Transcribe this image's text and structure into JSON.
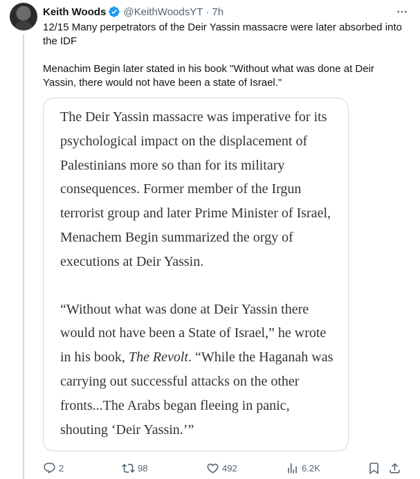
{
  "tweet": {
    "author_name": "Keith Woods",
    "handle": "@KeithWoodsYT",
    "separator": "·",
    "time": "7h",
    "text_lines": [
      "12/15 Many perpetrators of the Deir Yassin massacre were later absorbed into the IDF",
      "Menachim Begin later stated in his book \"Without what was done at Deir Yassin, there would not have been a state of Israel.\""
    ]
  },
  "media_quote": {
    "paragraph1": "The Deir Yassin massacre was imperative for its psychological impact on the displacement of Palestinians more so than for its military consequences. Former member of the Irgun terrorist group and later Prime Minister of Israel, Menachem Begin summarized the orgy of executions at Deir Yassin.",
    "paragraph2_pre": "“Without what was done at Deir Yassin there would not have been a State of Israel,” he wrote in his book, ",
    "paragraph2_book": "The Revolt",
    "paragraph2_post": ". “While the Haganah was carrying out successful attacks on the other fronts...The Arabs began fleeing in panic, shouting ‘Deir Yassin.’”"
  },
  "actions": {
    "replies": "2",
    "reposts": "98",
    "likes": "492",
    "views": "6.2K"
  },
  "icons": {
    "verified": "verified-badge-icon",
    "more": "more-options-icon",
    "reply": "reply-icon",
    "repost": "repost-icon",
    "like": "heart-icon",
    "views": "views-chart-icon",
    "bookmark": "bookmark-icon",
    "share": "share-icon"
  },
  "colors": {
    "verified": "#1d9bf0",
    "text": "#0f1419",
    "secondary": "#536471",
    "quote_text": "#333333"
  }
}
